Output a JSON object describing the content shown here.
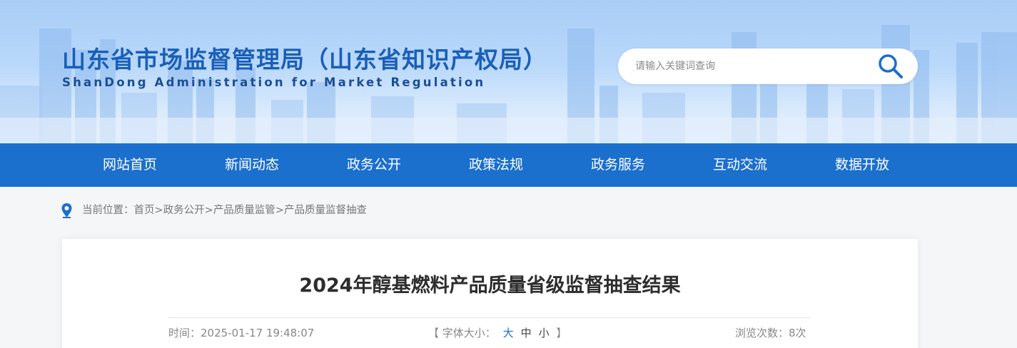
{
  "header": {
    "title": "山东省市场监督管理局（山东省知识产权局）",
    "subtitle": "ShanDong Administration for Market Regulation",
    "search_placeholder": "请输入关键词查询",
    "search_icon": "search-icon"
  },
  "nav": {
    "items": [
      {
        "label": "网站首页"
      },
      {
        "label": "新闻动态"
      },
      {
        "label": "政务公开"
      },
      {
        "label": "政策法规"
      },
      {
        "label": "政务服务"
      },
      {
        "label": "互动交流"
      },
      {
        "label": "数据开放"
      }
    ]
  },
  "breadcrumb": {
    "icon": "location-pin-icon",
    "prefix": "当前位置：",
    "separator": ">",
    "items": [
      "首页",
      "政务公开",
      "产品质量监管",
      "产品质量监督抽查"
    ]
  },
  "article": {
    "title": "2024年醇基燃料产品质量省级监督抽查结果",
    "time_label": "时间：",
    "time": "2025-01-17 19:48:07",
    "font_bracket_open": "【",
    "font_label": "字体大小：",
    "font_large": "大",
    "font_medium": "中",
    "font_small": "小",
    "font_bracket_close": "】",
    "views_label": "浏览次数：",
    "views": "8次"
  },
  "colors": {
    "nav_bg": "#1b6fcd",
    "title_blue": "#1a5fb8",
    "accent": "#1b6fcd"
  }
}
